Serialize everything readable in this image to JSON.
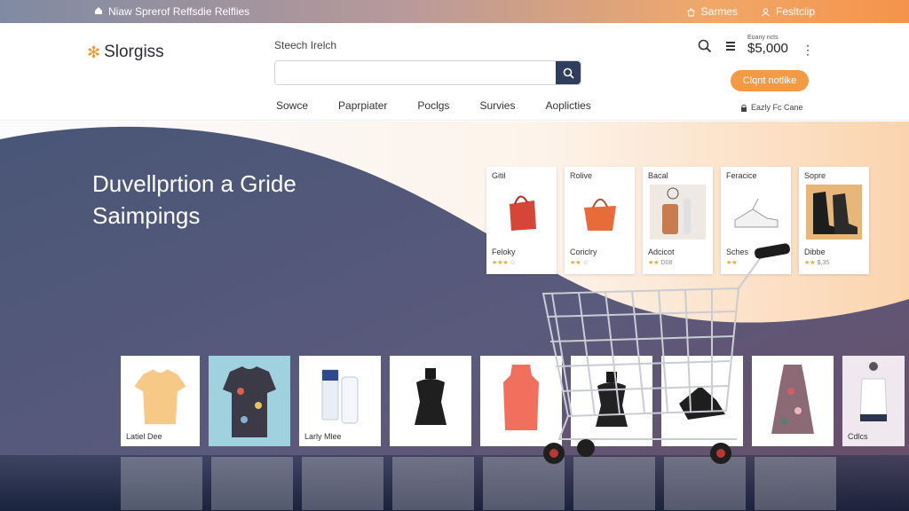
{
  "topbar": {
    "promo": "Niaw Sprerof Reffsdie  Relflies",
    "links": [
      "Sarmes",
      "Fesltclip"
    ]
  },
  "header": {
    "logo": "Slorgiss",
    "search_label": "Steech Irelch",
    "search_placeholder": "",
    "nav": [
      "Sowce",
      "Paprpiater",
      "Poclgs",
      "Survies",
      "Aoplicties"
    ],
    "cart_small": "Eoany ncts",
    "cart_total": "$5,000",
    "cta": "Clqnt notlike",
    "early": "Eazly Fc Cane"
  },
  "hero": {
    "title_line1": "Duvellprtion a Gride",
    "title_line2": "Saimpings"
  },
  "cards": [
    {
      "title": "Gitil",
      "name": "Feloky",
      "rating": "★★★",
      "rest": "☆"
    },
    {
      "title": "Rolive",
      "name": "Coriclry",
      "rating": "★★",
      "rest": "☆"
    },
    {
      "title": "Bacal",
      "name": "Adcicot",
      "rating": "★★",
      "rest": "D08"
    },
    {
      "title": "Feracice",
      "name": "Sches",
      "rating": "★★",
      "rest": ""
    },
    {
      "title": "Sopre",
      "name": "Dibbe",
      "rating": "★★",
      "rest": "$,35"
    }
  ],
  "products": [
    {
      "label": "Latiel Dee"
    },
    {
      "label": ""
    },
    {
      "label": "Larly Mlee"
    },
    {
      "label": ""
    },
    {
      "label": ""
    },
    {
      "label": ""
    },
    {
      "label": ""
    },
    {
      "label": ""
    },
    {
      "label": "Cdlcs"
    }
  ],
  "colors": {
    "accent": "#f39a45",
    "navy": "#2f3e5c",
    "hero_wave": "#4a5573"
  },
  "icons": [
    "home-icon",
    "bag-icon",
    "search-icon",
    "cart-icon",
    "more-icon",
    "lock-icon"
  ]
}
